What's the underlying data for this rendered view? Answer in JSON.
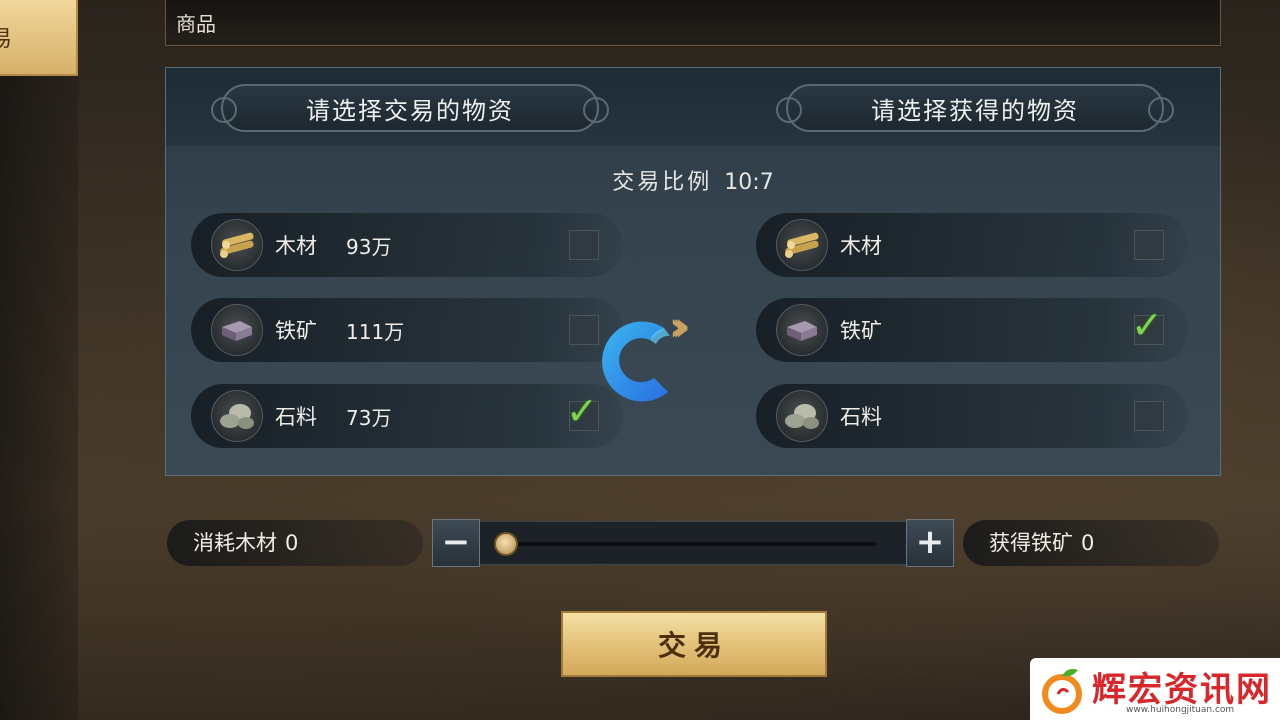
{
  "left_tab": {
    "label": "易"
  },
  "goods_bar": {
    "label": "商品"
  },
  "panel": {
    "left_title": "请选择交易的物资",
    "right_title": "请选择获得的物资",
    "ratio_label": "交易比例",
    "ratio_value": "10:7"
  },
  "give_items": [
    {
      "name": "木材",
      "qty": "93万",
      "icon": "wood-icon",
      "checked": false
    },
    {
      "name": "铁矿",
      "qty": "111万",
      "icon": "iron-ore-icon",
      "checked": false
    },
    {
      "name": "石料",
      "qty": "73万",
      "icon": "stone-icon",
      "checked": true
    }
  ],
  "get_items": [
    {
      "name": "木材",
      "icon": "wood-icon",
      "checked": false
    },
    {
      "name": "铁矿",
      "icon": "iron-ore-icon",
      "checked": true
    },
    {
      "name": "石料",
      "icon": "stone-icon",
      "checked": false
    }
  ],
  "controls": {
    "consume_label": "消耗木材",
    "consume_value": "0",
    "gain_label": "获得铁矿",
    "gain_value": "0",
    "minus_label": "−",
    "plus_label": "+",
    "slider_value": 0
  },
  "trade_button": {
    "label": "交易"
  },
  "watermark": {
    "title": "辉宏资讯网",
    "url": "www.huihongjituan.com"
  },
  "colors": {
    "accent_gold": "#d6b06a",
    "check_green": "#7fd34f",
    "panel_bg": "#35444f"
  }
}
